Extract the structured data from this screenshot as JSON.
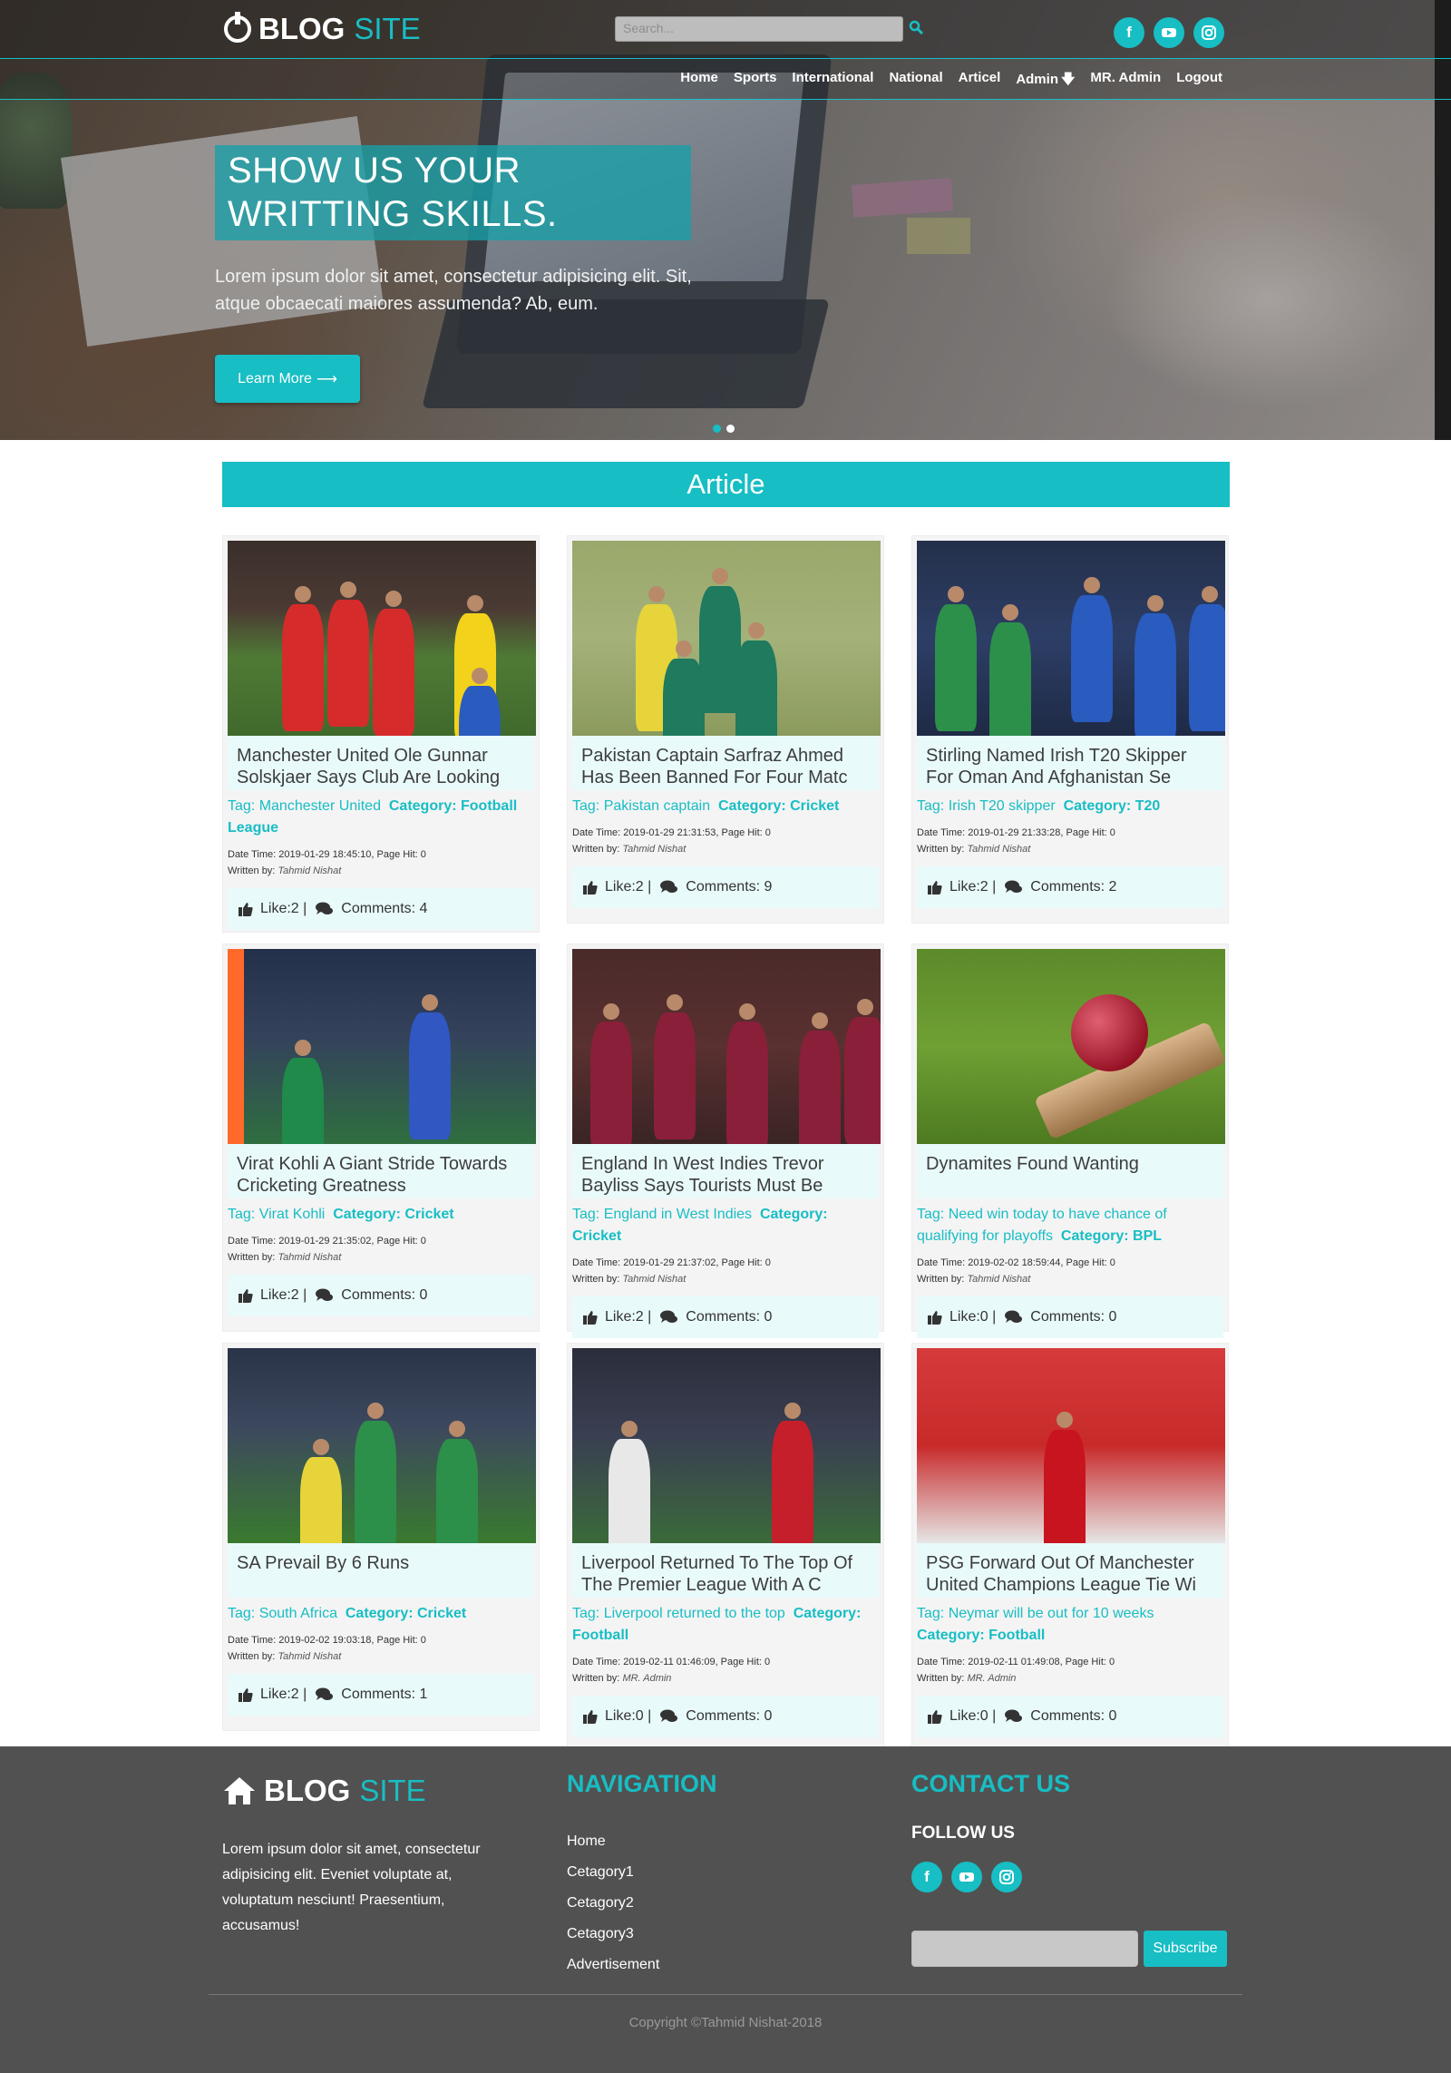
{
  "header": {
    "logo_bold": "BLOG",
    "logo_light": "SITE",
    "search_placeholder": "Search...",
    "social": [
      "facebook-icon",
      "youtube-icon",
      "instagram-icon"
    ]
  },
  "nav": {
    "items": [
      "Home",
      "Sports",
      "International",
      "National",
      "Articel",
      "Admin",
      "MR. Admin",
      "Logout"
    ]
  },
  "hero": {
    "title": "SHOW US YOUR WRITTING SKILLS.",
    "text": "Lorem ipsum dolor sit amet, consectetur adipisicing elit. Sit, atque obcaecati maiores assumenda? Ab, eum.",
    "button": "Learn More",
    "slides": 2,
    "active_slide": 1
  },
  "section": {
    "title": "Article"
  },
  "articles": [
    {
      "title": "Manchester United Ole Gunnar Solskjaer Says Club Are Looking",
      "tag": "Tag: Manchester United",
      "category": "Category: Football League",
      "datetime": "Date Time: 2019-01-29 18:45:10, Page Hit: 0",
      "written_label": "Written by:",
      "author": "Tahmid Nishat",
      "likes": "Like:2 |",
      "comments": "Comments: 4"
    },
    {
      "title": "Pakistan Captain Sarfraz Ahmed Has Been Banned For Four Matc",
      "tag": "Tag: Pakistan captain",
      "category": "Category: Cricket",
      "datetime": "Date Time: 2019-01-29 21:31:53, Page Hit: 0",
      "written_label": "Written by:",
      "author": "Tahmid Nishat",
      "likes": "Like:2 |",
      "comments": "Comments: 9"
    },
    {
      "title": "Stirling Named Irish T20 Skipper For Oman And Afghanistan Se",
      "tag": "Tag: Irish T20 skipper",
      "category": "Category: T20",
      "datetime": "Date Time: 2019-01-29 21:33:28, Page Hit: 0",
      "written_label": "Written by:",
      "author": "Tahmid Nishat",
      "likes": "Like:2 |",
      "comments": "Comments: 2"
    },
    {
      "title": "Virat Kohli A Giant Stride Towards Cricketing Greatness",
      "tag": "Tag: Virat Kohli",
      "category": "Category: Cricket",
      "datetime": "Date Time: 2019-01-29 21:35:02, Page Hit: 0",
      "written_label": "Written by:",
      "author": "Tahmid Nishat",
      "likes": "Like:2 |",
      "comments": "Comments: 0"
    },
    {
      "title": "England In West Indies Trevor Bayliss Says Tourists Must Be",
      "tag": "Tag: England in West Indies",
      "category": "Category: Cricket",
      "datetime": "Date Time: 2019-01-29 21:37:02, Page Hit: 0",
      "written_label": "Written by:",
      "author": "Tahmid Nishat",
      "likes": "Like:2 |",
      "comments": "Comments: 0"
    },
    {
      "title": "Dynamites Found Wanting",
      "tag": "Tag: Need win today to have chance of qualifying for playoffs",
      "category": "Category: BPL",
      "datetime": "Date Time: 2019-02-02 18:59:44, Page Hit: 0",
      "written_label": "Written by:",
      "author": "Tahmid Nishat",
      "likes": "Like:0 |",
      "comments": "Comments: 0"
    },
    {
      "title": "SA Prevail By 6 Runs",
      "tag": "Tag: South Africa",
      "category": "Category: Cricket",
      "datetime": "Date Time: 2019-02-02 19:03:18, Page Hit: 0",
      "written_label": "Written by:",
      "author": "Tahmid Nishat",
      "likes": "Like:2 |",
      "comments": "Comments: 1"
    },
    {
      "title": "Liverpool Returned To The Top Of The Premier League With A C",
      "tag": "Tag: Liverpool returned to the top",
      "category": "Category: Football",
      "datetime": "Date Time: 2019-02-11 01:46:09, Page Hit: 0",
      "written_label": "Written by:",
      "author": "MR. Admin",
      "likes": "Like:0 |",
      "comments": "Comments: 0"
    },
    {
      "title": "PSG Forward Out Of Manchester United Champions League Tie Wi",
      "tag": "Tag: Neymar will be out for 10 weeks",
      "category": "Category: Football",
      "datetime": "Date Time: 2019-02-11 01:49:08, Page Hit: 0",
      "written_label": "Written by:",
      "author": "MR. Admin",
      "likes": "Like:0 |",
      "comments": "Comments: 0"
    }
  ],
  "footer": {
    "logo_bold": "BLOG",
    "logo_light": "SITE",
    "about": "Lorem ipsum dolor sit amet, consectetur adipisicing elit. Eveniet voluptate at, voluptatum nesciunt! Praesentium, accusamus!",
    "nav_title": "NAVIGATION",
    "nav_links": [
      "Home",
      "Cetagory1",
      "Cetagory2",
      "Cetagory3",
      "Advertisement"
    ],
    "contact_title": "CONTACT US",
    "follow": "FOLLOW US",
    "subscribe": "Subscribe",
    "copyright": "Copyright ©Tahmid Nishat-2018"
  },
  "colors": {
    "accent": "#17bec4",
    "footer_bg": "#515151",
    "card_tint": "#e9fafb"
  }
}
